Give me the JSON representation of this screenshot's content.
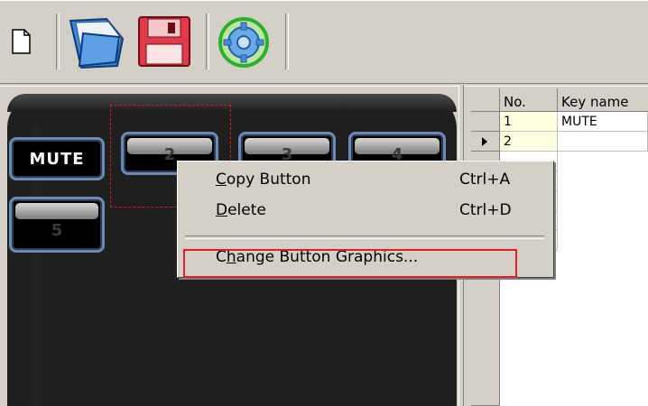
{
  "toolbar": {
    "buttons": [
      {
        "name": "new",
        "icon": "new-document-icon"
      },
      {
        "name": "open",
        "icon": "open-folder-icon"
      },
      {
        "name": "save",
        "icon": "floppy-disk-icon"
      },
      {
        "name": "settings",
        "icon": "gear-icon"
      }
    ]
  },
  "device": {
    "keys": [
      {
        "label": "MUTE"
      },
      {
        "label": "2"
      },
      {
        "label": "3"
      },
      {
        "label": "4"
      },
      {
        "label": "5"
      }
    ]
  },
  "grid": {
    "columns": [
      "No.",
      "Key name"
    ],
    "rows": [
      {
        "no": "1",
        "name": "MUTE"
      },
      {
        "no": "2",
        "name": ""
      }
    ]
  },
  "context_menu": {
    "items": [
      {
        "label": "Copy Button",
        "shortcut": "Ctrl+A",
        "mnemonic": "C"
      },
      {
        "label": "Delete",
        "shortcut": "Ctrl+D",
        "mnemonic": "D"
      },
      {
        "label": "Change Button Graphics...",
        "shortcut": "",
        "mnemonic": "h"
      }
    ]
  },
  "colors": {
    "selection_dashed": "#d81f1f",
    "highlight_box": "#e02020",
    "key_border": "#6a8bb3",
    "panel_bg": "#1f1f1f",
    "window_bg": "#d4d0c8"
  }
}
